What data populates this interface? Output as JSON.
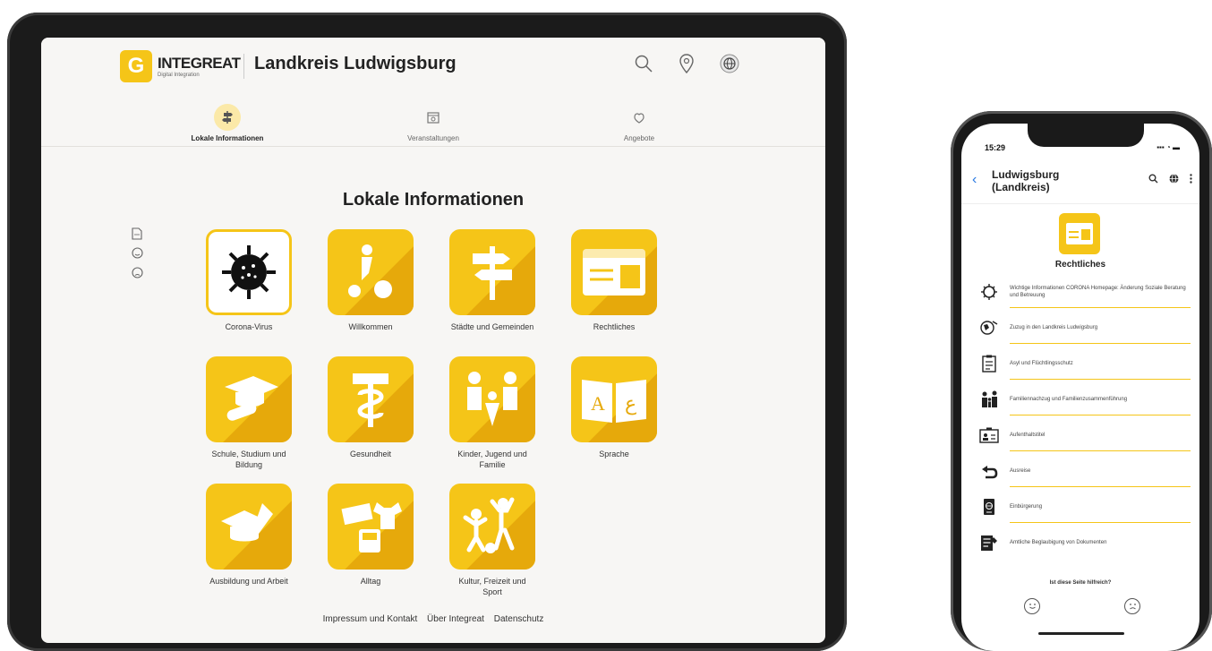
{
  "tablet": {
    "logo": {
      "mark": "G",
      "name": "INTEGREAT",
      "sub": "Digital Integration"
    },
    "region_title": "Landkreis Ludwigsburg",
    "header_icons": [
      "search-icon",
      "location-pin-icon",
      "language-globe-icon"
    ],
    "nav": [
      {
        "label": "Lokale Informationen",
        "icon": "signpost-icon",
        "active": true
      },
      {
        "label": "Veranstaltungen",
        "icon": "calendar-icon",
        "active": false
      },
      {
        "label": "Angebote",
        "icon": "offers-icon",
        "active": false
      }
    ],
    "page_title": "Lokale Informationen",
    "side_icons": [
      "pdf-icon",
      "happy-face-icon",
      "sad-face-icon"
    ],
    "tiles": [
      {
        "label": "Corona-Virus",
        "icon": "virus-icon"
      },
      {
        "label": "Willkommen",
        "icon": "welcome-icon"
      },
      {
        "label": "Städte und Gemeinden",
        "icon": "signpost-icon"
      },
      {
        "label": "Rechtliches",
        "icon": "id-card-icon"
      },
      {
        "label": "Schule, Studium und Bildung",
        "icon": "graduation-icon"
      },
      {
        "label": "Gesundheit",
        "icon": "health-icon"
      },
      {
        "label": "Kinder, Jugend und Familie",
        "icon": "family-icon"
      },
      {
        "label": "Sprache",
        "icon": "language-book-icon"
      },
      {
        "label": "Ausbildung und Arbeit",
        "icon": "training-icon"
      },
      {
        "label": "Alltag",
        "icon": "everyday-icon"
      },
      {
        "label": "Kultur, Freizeit und Sport",
        "icon": "sport-icon"
      }
    ],
    "footer": {
      "imprint": "Impressum und Kontakt",
      "about": "Über Integreat",
      "privacy": "Datenschutz"
    }
  },
  "phone": {
    "status_time": "15:29",
    "status_icons": "▪▪▪ ◔ ▬",
    "title_line1": "Ludwigsburg",
    "title_line2": "(Landkreis)",
    "back": "‹",
    "header_icons": [
      "search-icon",
      "language-icon",
      "more-icon"
    ],
    "category_title": "Rechtliches",
    "items": [
      {
        "text": "Wichtige Informationen CORONA Homepage: Änderung Soziale Beratung und Betreuung",
        "icon": "virus-icon"
      },
      {
        "text": "Zuzug in den Landkreis Ludwigsburg",
        "icon": "globe-icon"
      },
      {
        "text": "Asyl und Flüchtlingsschutz",
        "icon": "document-icon"
      },
      {
        "text": "Familiennachzug und Familienzusammenführung",
        "icon": "family-icon"
      },
      {
        "text": "Aufenthaltstitel",
        "icon": "id-card-icon"
      },
      {
        "text": "Ausreise",
        "icon": "return-icon"
      },
      {
        "text": "Einbürgerung",
        "icon": "passport-icon"
      },
      {
        "text": "Amtliche Beglaubigung von Dokumenten",
        "icon": "certified-document-icon"
      }
    ],
    "feedback_question": "Ist diese Seite hilfreich?"
  },
  "colors": {
    "accent": "#f5c518",
    "accent_dark": "#e6a90b",
    "text": "#222222",
    "link": "#2a7ae2"
  }
}
